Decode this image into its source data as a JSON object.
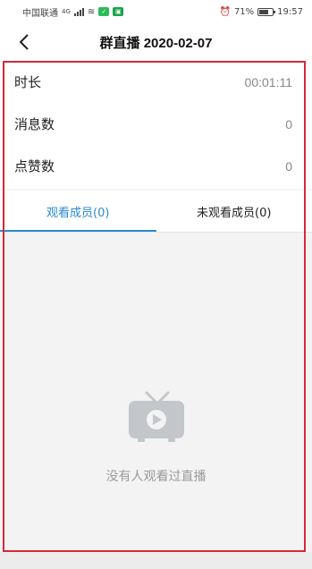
{
  "status_bar": {
    "carrier": "中国联通",
    "network": "4G",
    "battery": "71%",
    "battery_level": 0.71,
    "time": "19:57"
  },
  "header": {
    "title": "群直播 2020-02-07"
  },
  "stats": [
    {
      "label": "时长",
      "value": "00:01:11"
    },
    {
      "label": "消息数",
      "value": "0"
    },
    {
      "label": "点赞数",
      "value": "0"
    }
  ],
  "tabs": [
    {
      "label": "观看成员(0)",
      "active": true
    },
    {
      "label": "未观看成员(0)",
      "active": false
    }
  ],
  "empty_state": {
    "message": "没有人观看过直播",
    "icon": "tv-play-icon"
  },
  "colors": {
    "accent": "#2a8ad0",
    "highlight": "#d6283a",
    "muted_text": "#9a9a9a"
  }
}
